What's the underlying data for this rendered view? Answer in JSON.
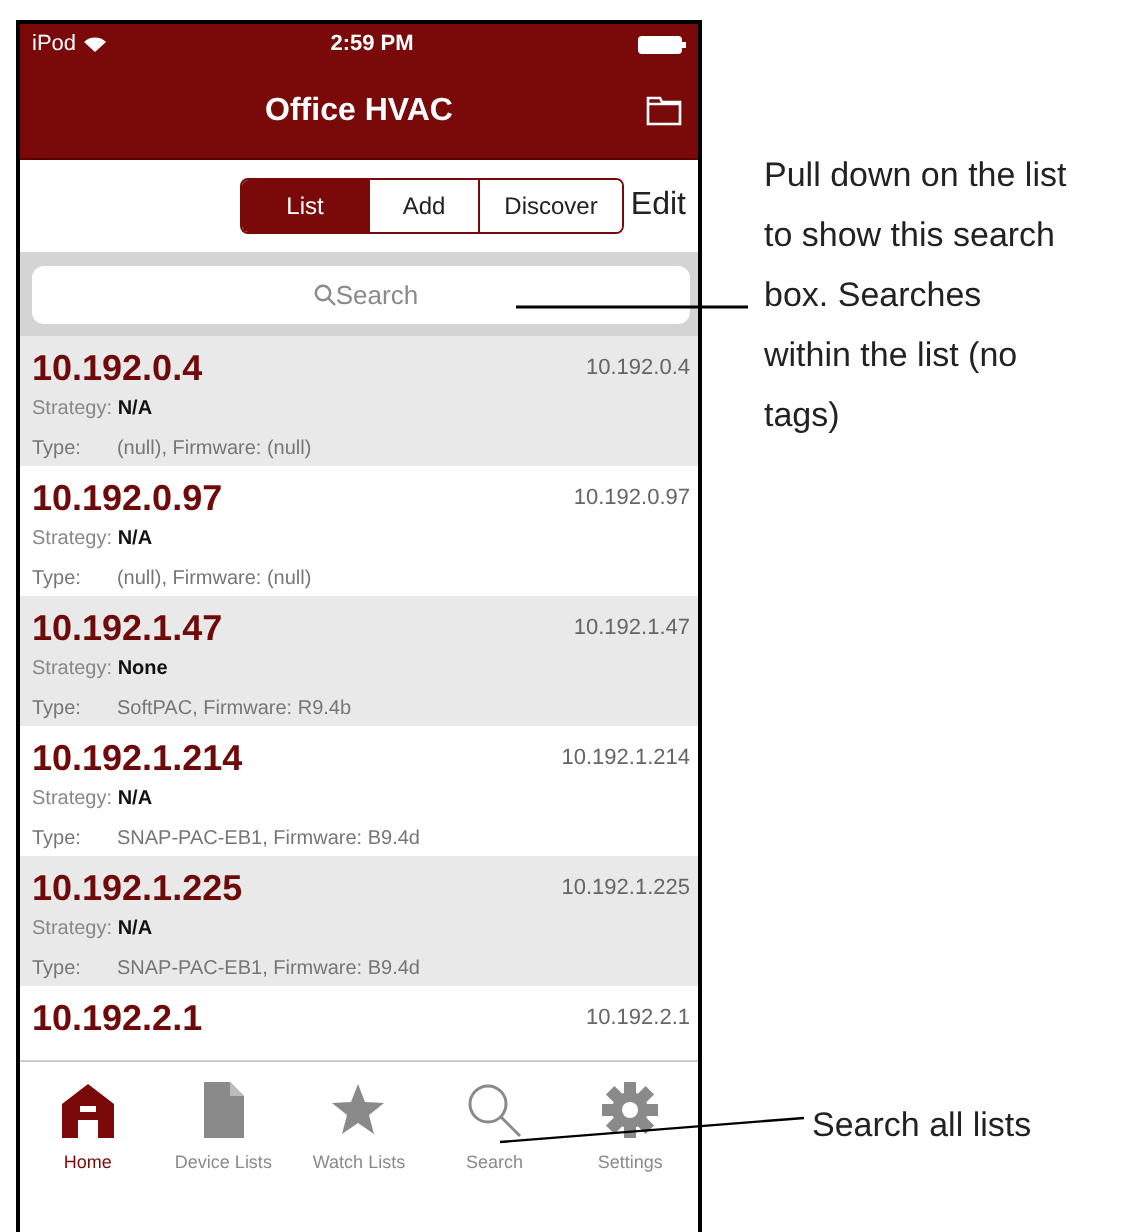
{
  "status_bar": {
    "carrier": "iPod",
    "time": "2:59 PM"
  },
  "nav_bar": {
    "title": "Office HVAC"
  },
  "segments": [
    {
      "label": "List",
      "selected": true
    },
    {
      "label": "Add",
      "selected": false
    },
    {
      "label": "Discover",
      "selected": false
    }
  ],
  "edit_button": "Edit",
  "search": {
    "placeholder": "Search"
  },
  "devices": [
    {
      "name": "10.192.0.4",
      "address": "10.192.0.4",
      "strategy_label": "Strategy:",
      "strategy": "N/A",
      "type_label": "Type:",
      "details": "(null), Firmware: (null)"
    },
    {
      "name": "10.192.0.97",
      "address": "10.192.0.97",
      "strategy_label": "Strategy:",
      "strategy": "N/A",
      "type_label": "Type:",
      "details": "(null), Firmware: (null)"
    },
    {
      "name": "10.192.1.47",
      "address": "10.192.1.47",
      "strategy_label": "Strategy:",
      "strategy": "None",
      "type_label": "Type:",
      "details": "SoftPAC, Firmware: R9.4b"
    },
    {
      "name": "10.192.1.214",
      "address": "10.192.1.214",
      "strategy_label": "Strategy:",
      "strategy": "N/A",
      "type_label": "Type:",
      "details": "SNAP-PAC-EB1, Firmware: B9.4d"
    },
    {
      "name": "10.192.1.225",
      "address": "10.192.1.225",
      "strategy_label": "Strategy:",
      "strategy": "N/A",
      "type_label": "Type:",
      "details": "SNAP-PAC-EB1, Firmware: B9.4d"
    },
    {
      "name": "10.192.2.1",
      "address": "10.192.2.1"
    }
  ],
  "tab_bar": [
    {
      "label": "Home",
      "kind": "home",
      "selected": true
    },
    {
      "label": "Device Lists",
      "kind": "document",
      "selected": false
    },
    {
      "label": "Watch Lists",
      "kind": "star",
      "selected": false
    },
    {
      "label": "Search",
      "kind": "search",
      "selected": false
    },
    {
      "label": "Settings",
      "kind": "gear",
      "selected": false
    }
  ],
  "callouts": [
    {
      "text": "Pull down on the list to show this search box. Searches within the list (no tags)"
    },
    {
      "text": "Search all lists"
    }
  ]
}
